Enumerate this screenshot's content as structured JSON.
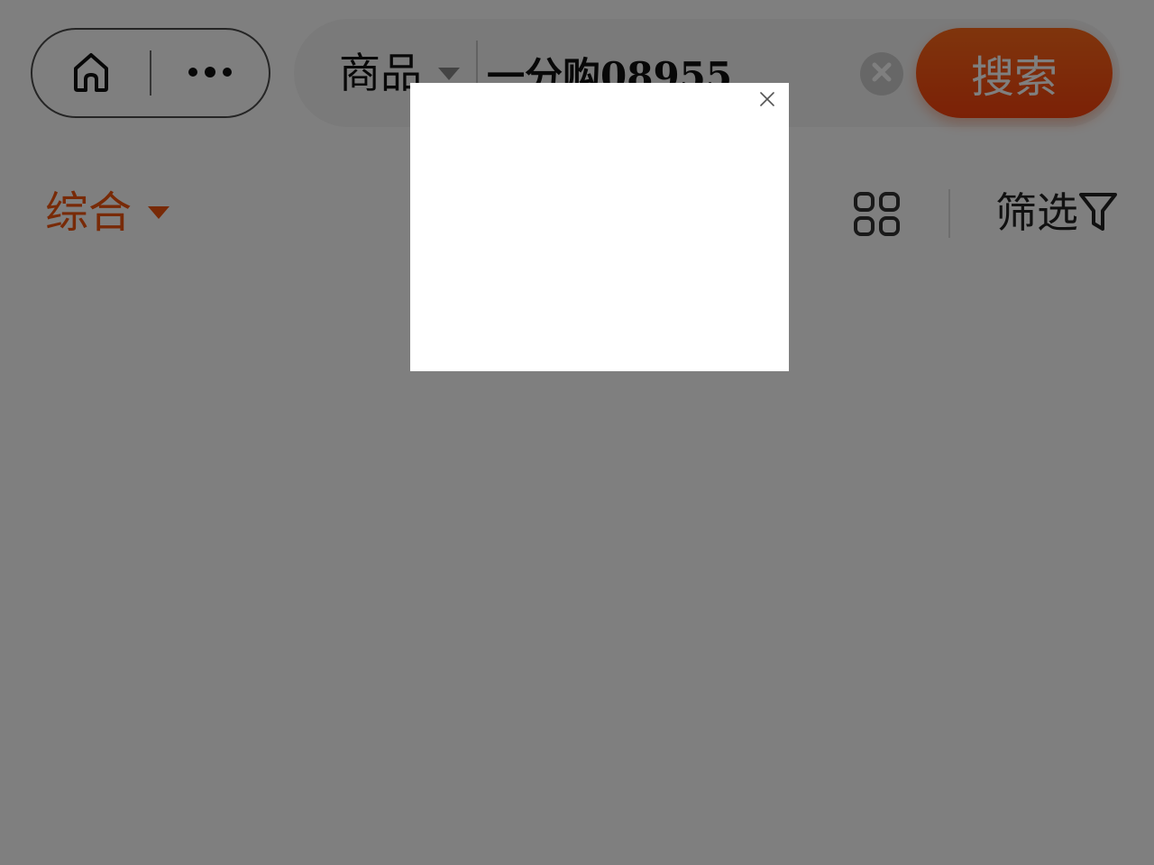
{
  "nav": {
    "home_icon": "home-icon",
    "more_icon": "more-dots-icon"
  },
  "search": {
    "scope_label": "商品",
    "query": "一分购08955",
    "search_button_label": "搜索",
    "clear_icon": "clear-icon"
  },
  "sort_bar": {
    "default_sort_label": "综合",
    "grid_icon": "grid-view-icon",
    "filter_label": "筛选",
    "filter_icon": "funnel-icon"
  },
  "modal": {
    "close_icon": "close-icon"
  },
  "colors": {
    "accent": "#f0550f",
    "search_button": "#f7420d",
    "overlay": "rgba(0,0,0,0.5)"
  }
}
